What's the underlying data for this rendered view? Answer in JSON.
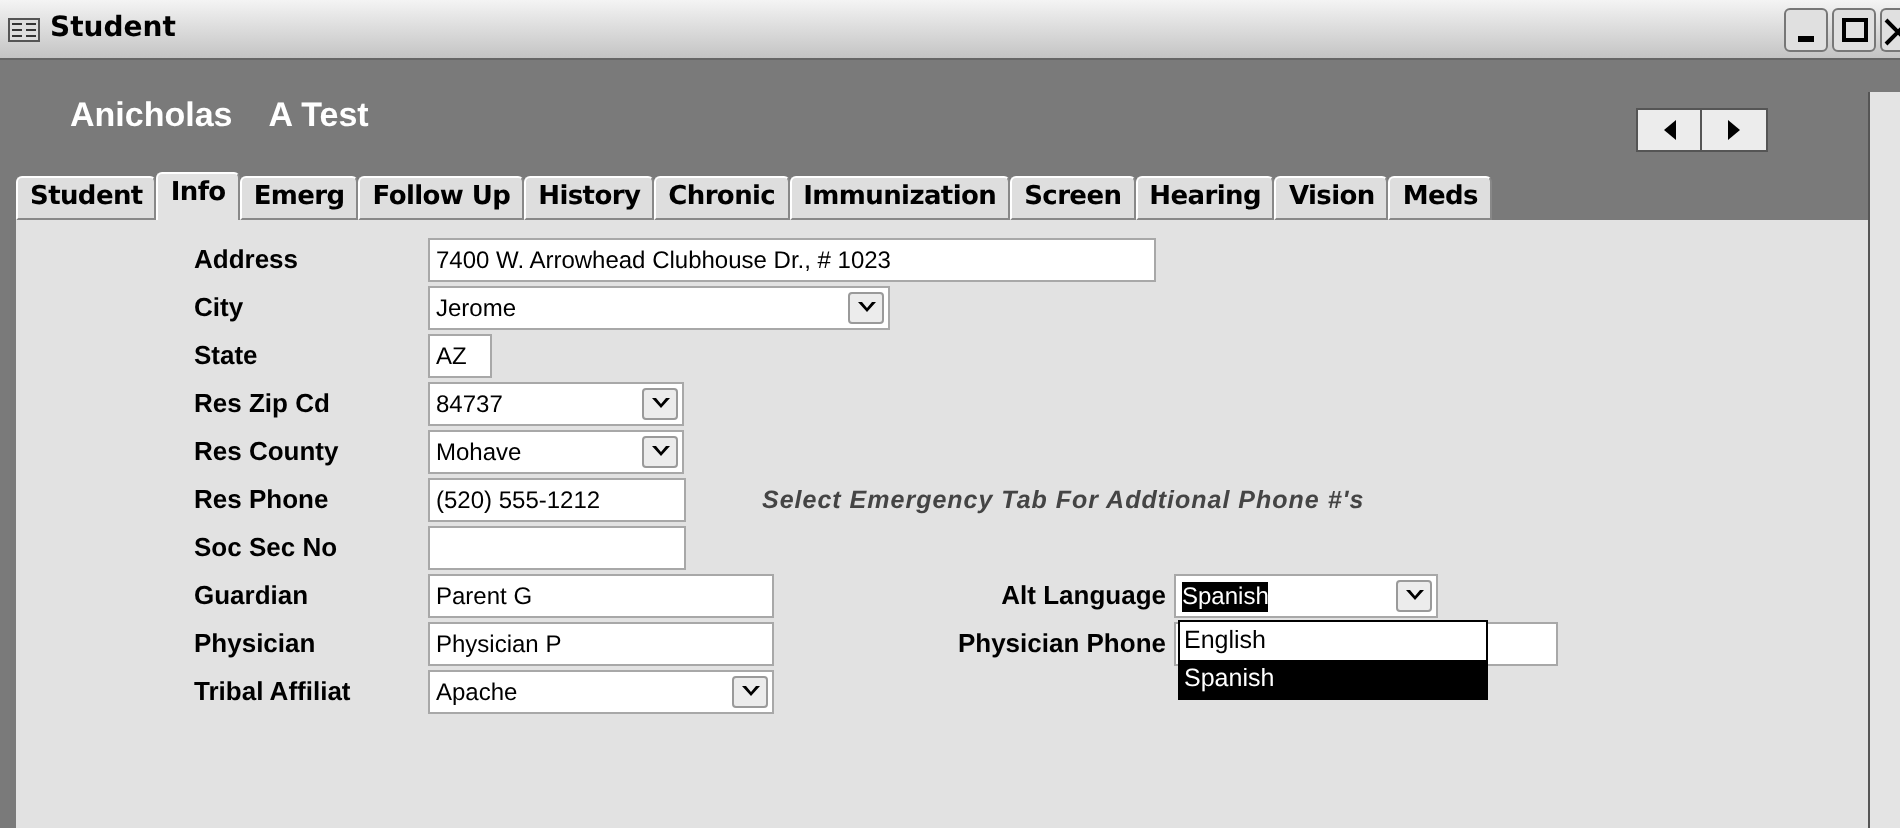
{
  "window": {
    "title": "Student"
  },
  "header": {
    "first_name": "Anicholas",
    "last_name": "A Test"
  },
  "tabs": [
    {
      "label": "Student",
      "selected": false
    },
    {
      "label": "Info",
      "selected": true
    },
    {
      "label": "Emerg",
      "selected": false
    },
    {
      "label": "Follow Up",
      "selected": false
    },
    {
      "label": "History",
      "selected": false
    },
    {
      "label": "Chronic",
      "selected": false
    },
    {
      "label": "Immunization",
      "selected": false
    },
    {
      "label": "Screen",
      "selected": false
    },
    {
      "label": "Hearing",
      "selected": false
    },
    {
      "label": "Vision",
      "selected": false
    },
    {
      "label": "Meds",
      "selected": false
    }
  ],
  "rows": [
    {
      "label": "Address",
      "kind": "text",
      "value": "7400 W. Arrowhead Clubhouse Dr., # 1023"
    },
    {
      "label": "City",
      "kind": "combo",
      "value": "Jerome"
    },
    {
      "label": "State",
      "kind": "text",
      "value": "AZ"
    },
    {
      "label": "Res Zip Cd",
      "kind": "combo",
      "value": "84737"
    },
    {
      "label": "Res County",
      "kind": "combo",
      "value": "Mohave"
    },
    {
      "label": "Res Phone",
      "kind": "text",
      "value": "(520) 555-1212",
      "side": {
        "kind": "note",
        "text": "Select Emergency Tab For Addtional Phone #'s"
      }
    },
    {
      "label": "Soc Sec No",
      "kind": "text"
    },
    {
      "label": "Guardian",
      "kind": "text",
      "value": "Parent G",
      "side": {
        "kind": "combo",
        "label": "Alt Language",
        "value": "Spanish",
        "open": true,
        "options": [
          {
            "label": "English",
            "selected": false
          },
          {
            "label": "Spanish",
            "selected": true
          }
        ]
      }
    },
    {
      "label": "Physician",
      "kind": "text",
      "value": "Physician P",
      "side": {
        "kind": "text",
        "label": "Physician Phone"
      }
    },
    {
      "label": "Tribal Affiliat",
      "kind": "combo",
      "value": "Apache"
    }
  ]
}
